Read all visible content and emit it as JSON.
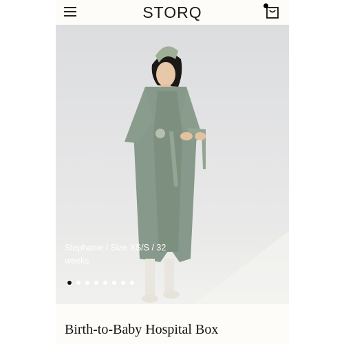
{
  "header": {
    "logo_text": "STORQ",
    "menu_icon": "hamburger-menu-icon",
    "cart_icon": "shopping-bag-icon"
  },
  "gallery": {
    "caption": "Stephanie / Size XS/S / 32 weeks",
    "total_slides": 8,
    "active_slide": 1
  },
  "product": {
    "title": "Birth-to-Baby Hospital Box"
  },
  "colors": {
    "background": "#fdfcf9",
    "robe": "#8a9c87",
    "text": "#111111"
  }
}
